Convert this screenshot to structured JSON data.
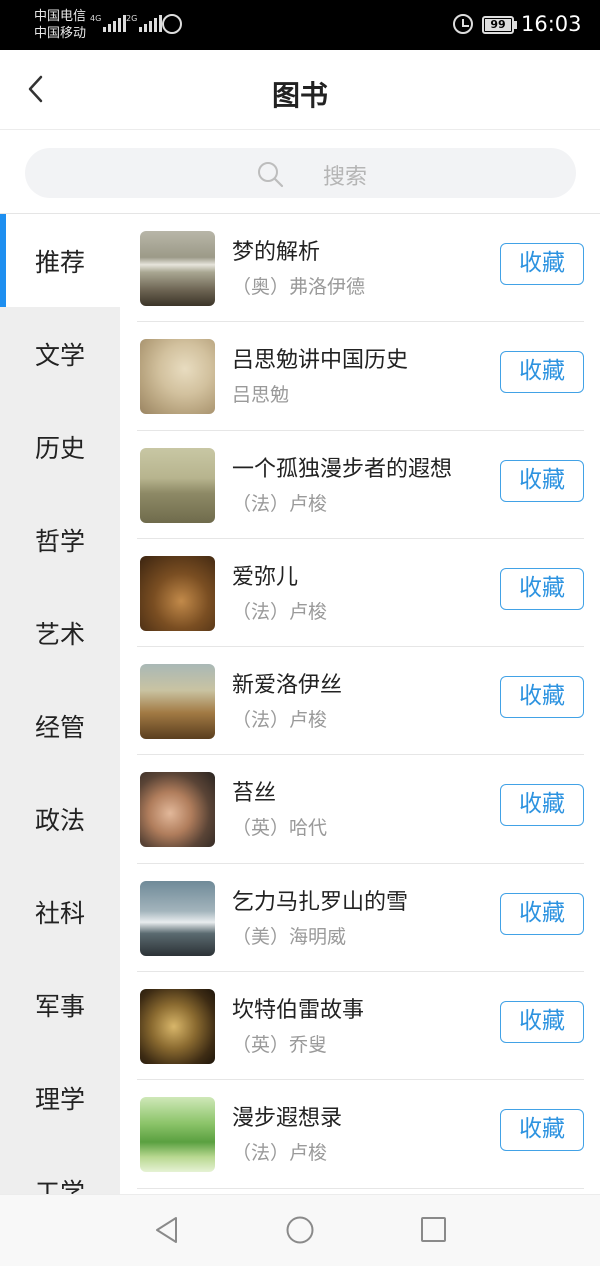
{
  "status_bar": {
    "carrier_1": "中国电信",
    "carrier_2": "中国移动",
    "signal_1_tag": "4G",
    "signal_2_tag": "2G",
    "battery": "99",
    "time": "16:03"
  },
  "header": {
    "title": "图书"
  },
  "search": {
    "placeholder": "搜索"
  },
  "categories": [
    {
      "label": "推荐",
      "active": true
    },
    {
      "label": "文学"
    },
    {
      "label": "历史"
    },
    {
      "label": "哲学"
    },
    {
      "label": "艺术"
    },
    {
      "label": "经管"
    },
    {
      "label": "政法"
    },
    {
      "label": "社科"
    },
    {
      "label": "军事"
    },
    {
      "label": "理学"
    },
    {
      "label": "工学"
    }
  ],
  "books": [
    {
      "title": "梦的解析",
      "author": "（奥）弗洛伊德",
      "button": "收藏"
    },
    {
      "title": "吕思勉讲中国历史",
      "author": "吕思勉",
      "button": "收藏"
    },
    {
      "title": "一个孤独漫步者的遐想",
      "author": "（法）卢梭",
      "button": "收藏"
    },
    {
      "title": "爱弥儿",
      "author": "（法）卢梭",
      "button": "收藏"
    },
    {
      "title": "新爱洛伊丝",
      "author": "（法）卢梭",
      "button": "收藏"
    },
    {
      "title": "苔丝",
      "author": "（英）哈代",
      "button": "收藏"
    },
    {
      "title": "乞力马扎罗山的雪",
      "author": "（美）海明威",
      "button": "收藏"
    },
    {
      "title": "坎特伯雷故事",
      "author": "（英）乔叟",
      "button": "收藏"
    },
    {
      "title": "漫步遐想录",
      "author": "（法）卢梭",
      "button": "收藏"
    }
  ],
  "colors": {
    "accent": "#1e8ff0",
    "button_border": "#42a2e6",
    "sidebar_bg": "#eeeeee"
  },
  "icons": {
    "back": "chevron-left-icon",
    "search": "search-icon",
    "nav_back": "triangle-back-icon",
    "nav_home": "circle-home-icon",
    "nav_recent": "square-recent-icon"
  }
}
